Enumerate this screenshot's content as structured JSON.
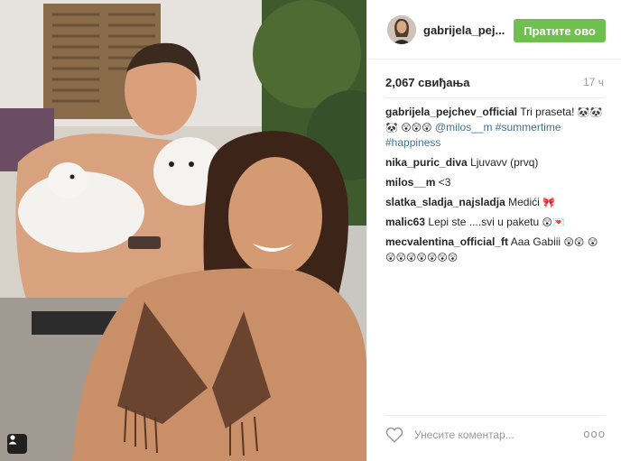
{
  "post": {
    "username": "gabrijela_pej...",
    "follow_label": "Пратите ово",
    "likes": "2,067 свиђања",
    "time": "17 ч"
  },
  "comments": [
    {
      "user": "gabrijela_pejchev_official",
      "text": "Tri praseta!",
      "emoji": "🐼🐼🐼 😲😲😲",
      "mention": "@milos__m #summertime #happiness"
    },
    {
      "user": "nika_puric_diva",
      "text": "Ljuvavv (prvq)"
    },
    {
      "user": "milos__m",
      "text": "<3"
    },
    {
      "user": "slatka_sladja_najsladja",
      "text": "Medići",
      "emoji": "🎀"
    },
    {
      "user": "malic63",
      "text": "Lepi ste ....svi u paketu",
      "emoji": "😲💌"
    },
    {
      "user": "mecvalentina_official_ft",
      "text": "Aaa Gabiii",
      "emoji": "😲😲 😲😲😲😲😲😲😲😲"
    }
  ],
  "footer": {
    "comment_placeholder": "Унесите коментар...",
    "more_label": "ooo"
  },
  "colors": {
    "follow": "#70c050",
    "link": "#3f729b"
  }
}
